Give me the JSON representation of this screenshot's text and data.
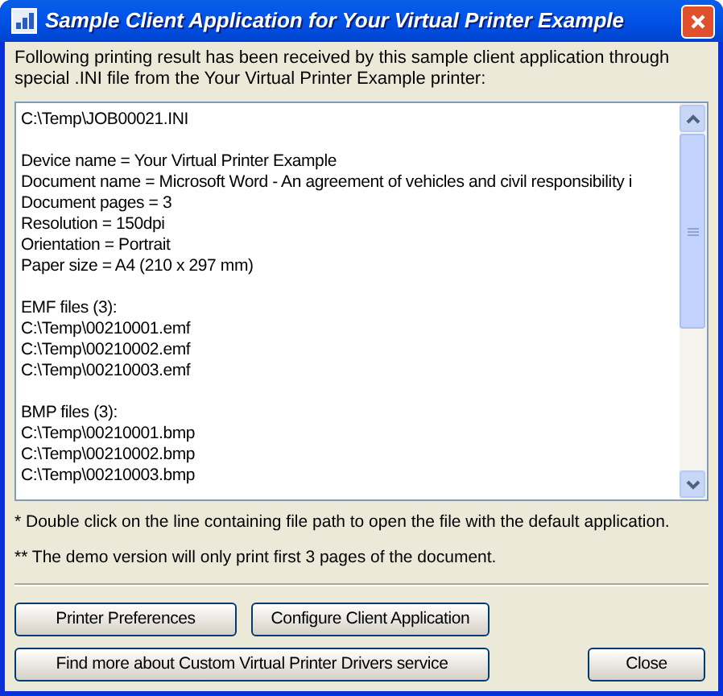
{
  "window": {
    "title": "Sample Client Application for Your Virtual Printer Example"
  },
  "intro": "Following printing result has been received by this sample client application through special .INI file from the Your Virtual Printer Example printer:",
  "result_groups": [
    {
      "lines": [
        "C:\\Temp\\JOB00021.INI"
      ]
    },
    {
      "lines": [
        "Device name = Your Virtual Printer Example",
        "Document name = Microsoft Word - An agreement of vehicles and civil responsibility i",
        "Document pages = 3",
        "Resolution = 150dpi",
        "Orientation = Portrait",
        "Paper size = A4 (210 x 297 mm)"
      ]
    },
    {
      "lines": [
        "EMF files (3):",
        "C:\\Temp\\00210001.emf",
        "C:\\Temp\\00210002.emf",
        "C:\\Temp\\00210003.emf"
      ]
    },
    {
      "lines": [
        "BMP files (3):",
        "C:\\Temp\\00210001.bmp",
        "C:\\Temp\\00210002.bmp",
        "C:\\Temp\\00210003.bmp"
      ]
    }
  ],
  "notes": [
    "* Double click on the line containing file path to open the file with the default application.",
    "** The demo version will only print first 3 pages of the document."
  ],
  "buttons_row_1": [
    "Printer Preferences",
    "Configure Client Application"
  ],
  "buttons_row_2": [
    "Find more about Custom Virtual Printer Drivers service",
    "Close"
  ]
}
